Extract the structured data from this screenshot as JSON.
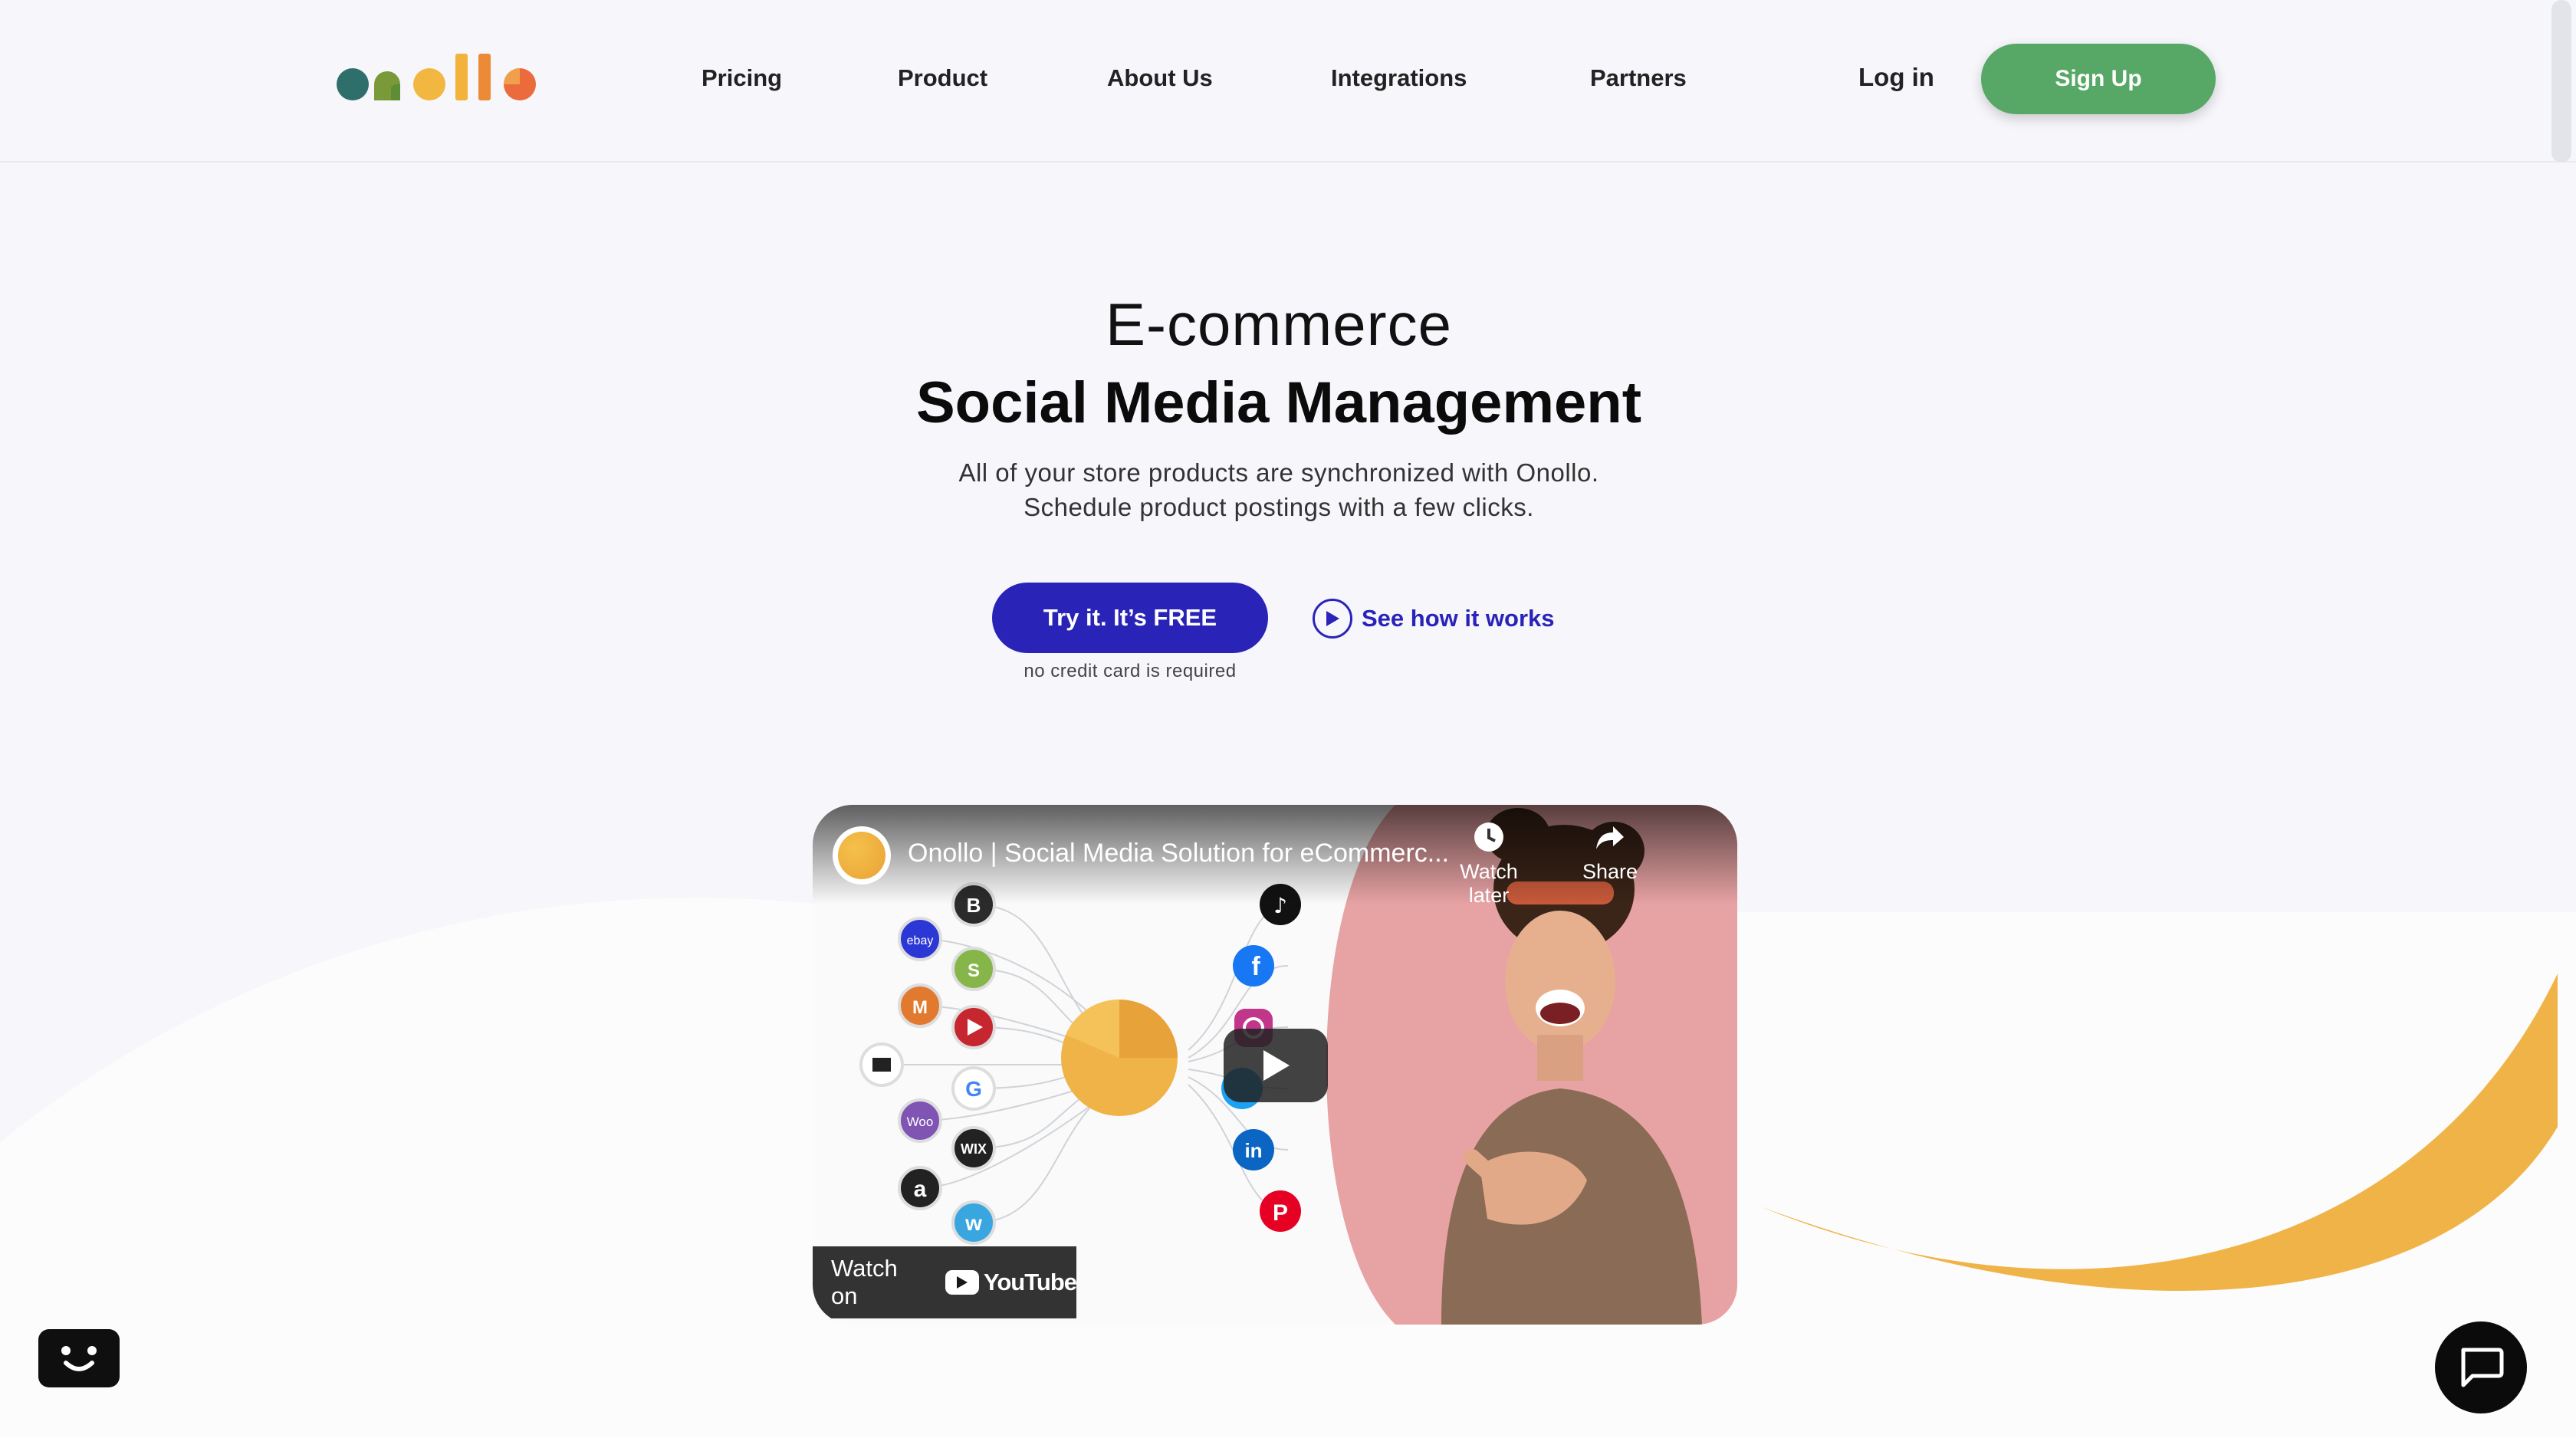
{
  "brand": {
    "logo_text": "onollo",
    "logo_colors": [
      "#2f6f6b",
      "#7a9a3a",
      "#f1b740",
      "#e6873a",
      "#ec6b3c"
    ]
  },
  "nav": {
    "items": [
      {
        "label": "Pricing"
      },
      {
        "label": "Product"
      },
      {
        "label": "About Us"
      },
      {
        "label": "Integrations"
      },
      {
        "label": "Partners"
      }
    ],
    "login_label": "Log in",
    "signup_label": "Sign Up"
  },
  "hero": {
    "pre_title": "E-commerce",
    "title": "Social Media Management",
    "subtitle_line1": "All of your store products are synchronized with Onollo.",
    "subtitle_line2": "Schedule product postings with a few clicks.",
    "cta_label": "Try it. It’s FREE",
    "cta_note": "no credit card is required",
    "how_label": "See how it works"
  },
  "video": {
    "title": "Onollo | Social Media Solution for eCommerc...",
    "watch_later": "Watch later",
    "share": "Share",
    "watch_on": "Watch on",
    "youtube": "YouTube",
    "left_icons": [
      "bigcommerce-icon",
      "ebay-icon",
      "shopify-icon",
      "magento-icon",
      "youtube-icon",
      "square-icon",
      "google-icon",
      "woocommerce-icon",
      "wix-icon",
      "amazon-icon",
      "weebly-icon"
    ],
    "left_icon_labels": {
      "ebay": "ebay",
      "woo": "Woo",
      "wix": "WIX",
      "amazon": "a",
      "weebly": "w",
      "google": "G"
    },
    "right_icons": [
      "tiktok-icon",
      "facebook-icon",
      "instagram-icon",
      "twitter-icon",
      "linkedin-icon",
      "pinterest-icon"
    ],
    "right_icon_labels": {
      "facebook": "f",
      "linkedin": "in",
      "pinterest": "P"
    }
  },
  "colors": {
    "background": "#f6f6fb",
    "signup": "#57a866",
    "primary": "#2a23b8",
    "wave_orange": "#f0b347",
    "video_pink": "#e7a2a4"
  }
}
